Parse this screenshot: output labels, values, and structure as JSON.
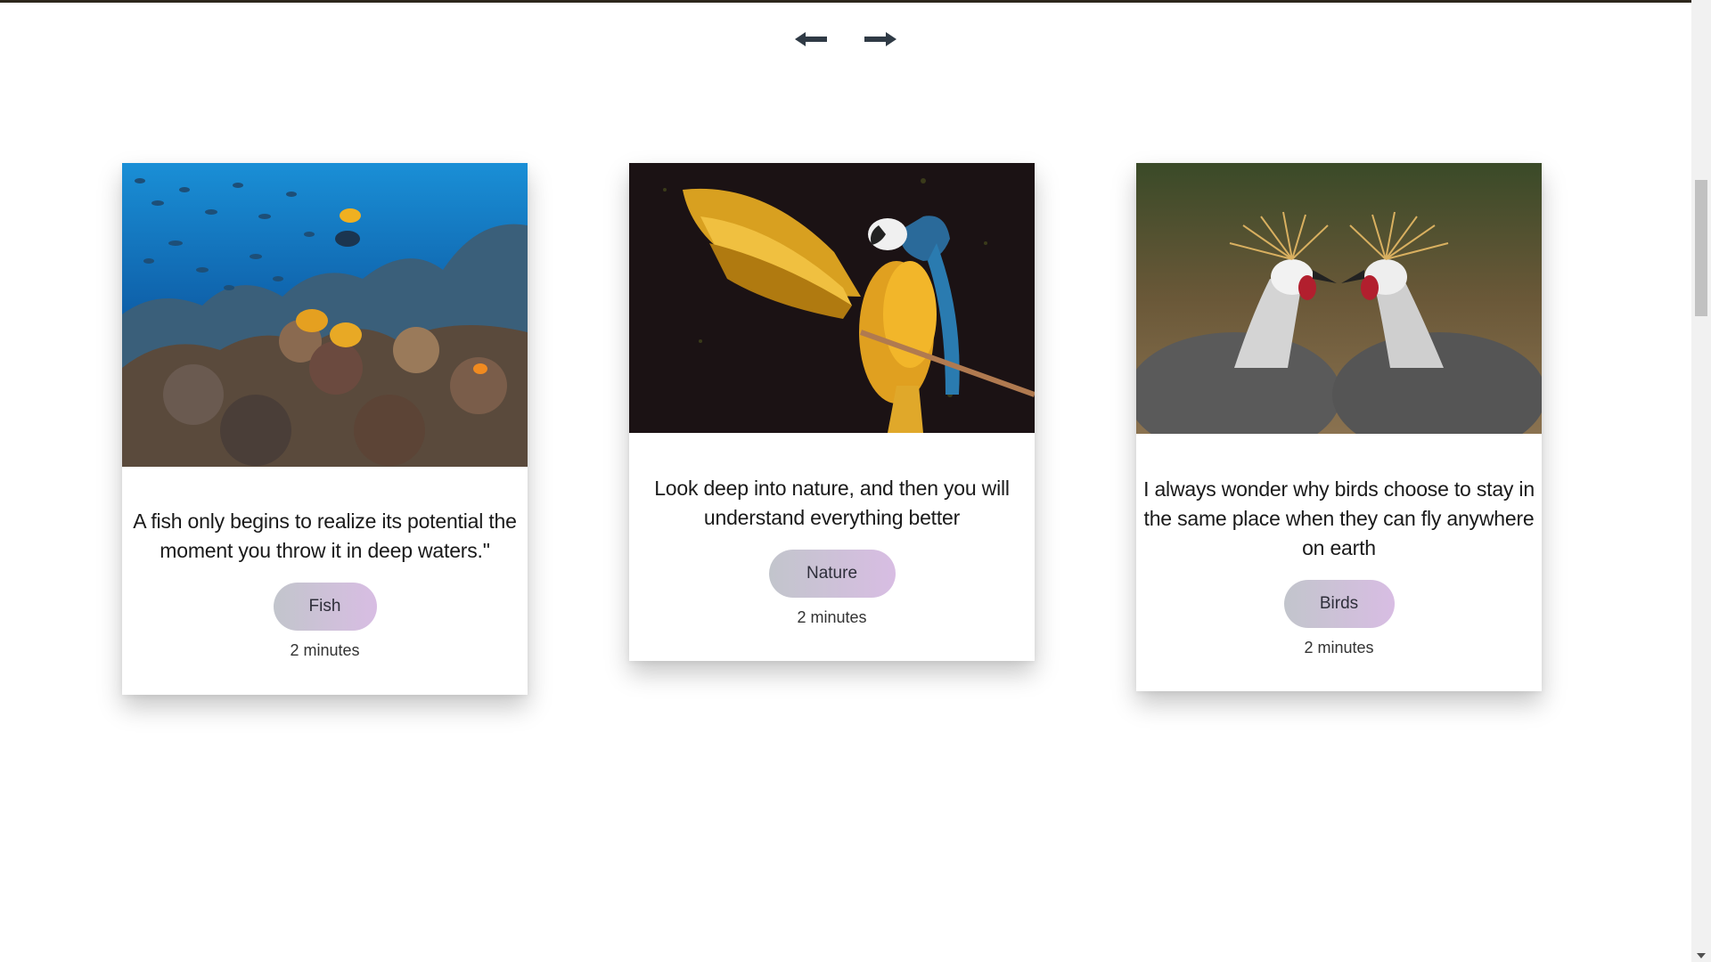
{
  "navigation": {
    "prev_icon": "arrow-left-icon",
    "next_icon": "arrow-right-icon",
    "arrow_color": "#2f3a45"
  },
  "cards": [
    {
      "image": "coral-reef-fish-photo",
      "quote": "A fish only begins to realize its potential the moment you throw it in deep waters.\"",
      "tag": "Fish",
      "duration": "2 minutes"
    },
    {
      "image": "macaw-parrot-photo",
      "quote": "Look deep into nature, and then you will understand everything better",
      "tag": "Nature",
      "duration": "2 minutes"
    },
    {
      "image": "crowned-cranes-photo",
      "quote": "I always wonder why birds choose to stay in the same place when they can fly anywhere on earth",
      "tag": "Birds",
      "duration": "2 minutes"
    }
  ],
  "colors": {
    "tag_gradient_start": "#c2c5cc",
    "tag_gradient_end": "#d8bde3",
    "page_background": "#ffffff"
  }
}
